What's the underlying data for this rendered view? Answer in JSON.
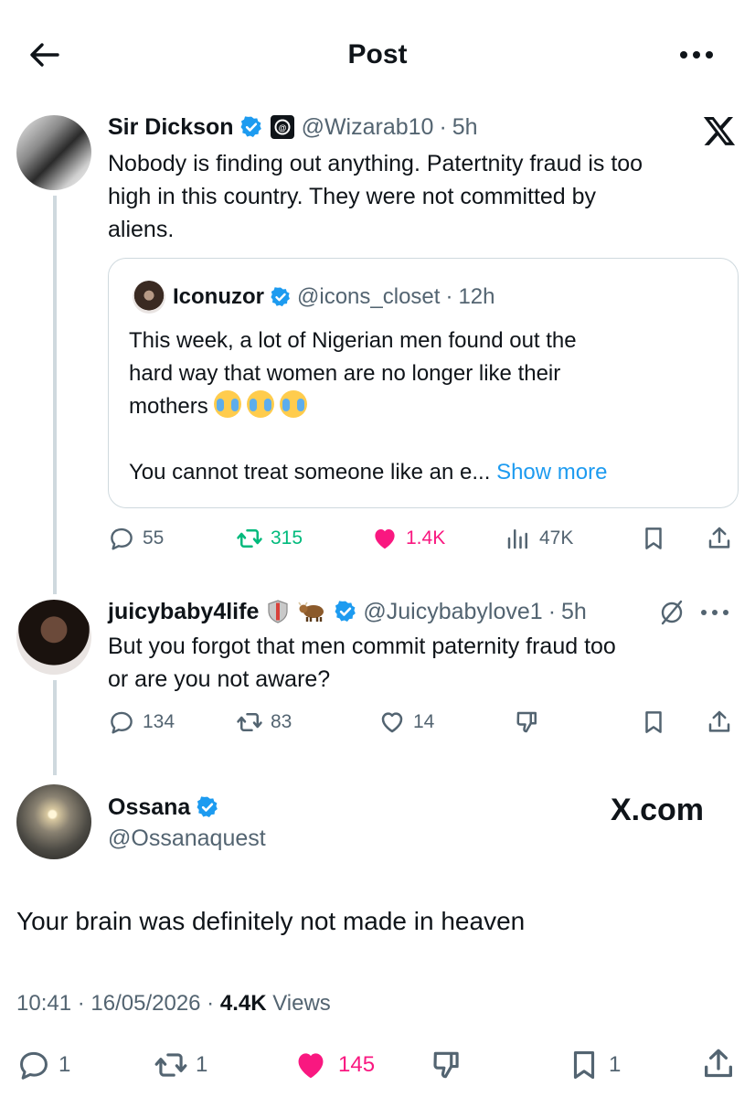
{
  "header": {
    "title": "Post"
  },
  "tweet1": {
    "name": "Sir Dickson",
    "handle": "@Wizarab10",
    "time": "5h",
    "text_lines": [
      "Nobody is finding out anything. Patertnity fraud is too",
      "high in this country. They were not committed by",
      "aliens."
    ],
    "stats": {
      "replies": "55",
      "reposts": "315",
      "likes": "1.4K",
      "views": "47K"
    }
  },
  "quote": {
    "name": "Iconuzor",
    "handle": "@icons_closet",
    "time": "12h",
    "text_lines": [
      "This week, a lot of Nigerian men found out the",
      "hard way that women are no longer like their",
      "mothers"
    ],
    "text_line4": "You cannot treat someone like an e...",
    "show_more": "Show more"
  },
  "tweet2": {
    "name": "juicybaby4life",
    "handle": "@Juicybabylove1",
    "time": "5h",
    "text_lines": [
      "But you forgot that men commit paternity fraud too",
      "or are you not aware?"
    ],
    "stats": {
      "replies": "134",
      "reposts": "83",
      "likes": "14"
    }
  },
  "tweet3": {
    "name": "Ossana",
    "handle": "@Ossanaquest",
    "text": "Your brain was definitely not made in heaven",
    "watermark": "X.com",
    "time": "10:41",
    "date": "16/05/2026",
    "views": "4.4K",
    "views_label": "Views",
    "stats": {
      "replies": "1",
      "reposts": "1",
      "likes": "145",
      "bookmarks": "1"
    }
  },
  "colors": {
    "accent": "#1d9bf0",
    "like": "#f91880",
    "repost": "#00ba7c",
    "muted": "#536471"
  },
  "icons": [
    "back-arrow",
    "more-horizontal",
    "verified-badge",
    "x-logo",
    "reply",
    "repost",
    "like",
    "views",
    "bookmark",
    "share",
    "dislike"
  ]
}
